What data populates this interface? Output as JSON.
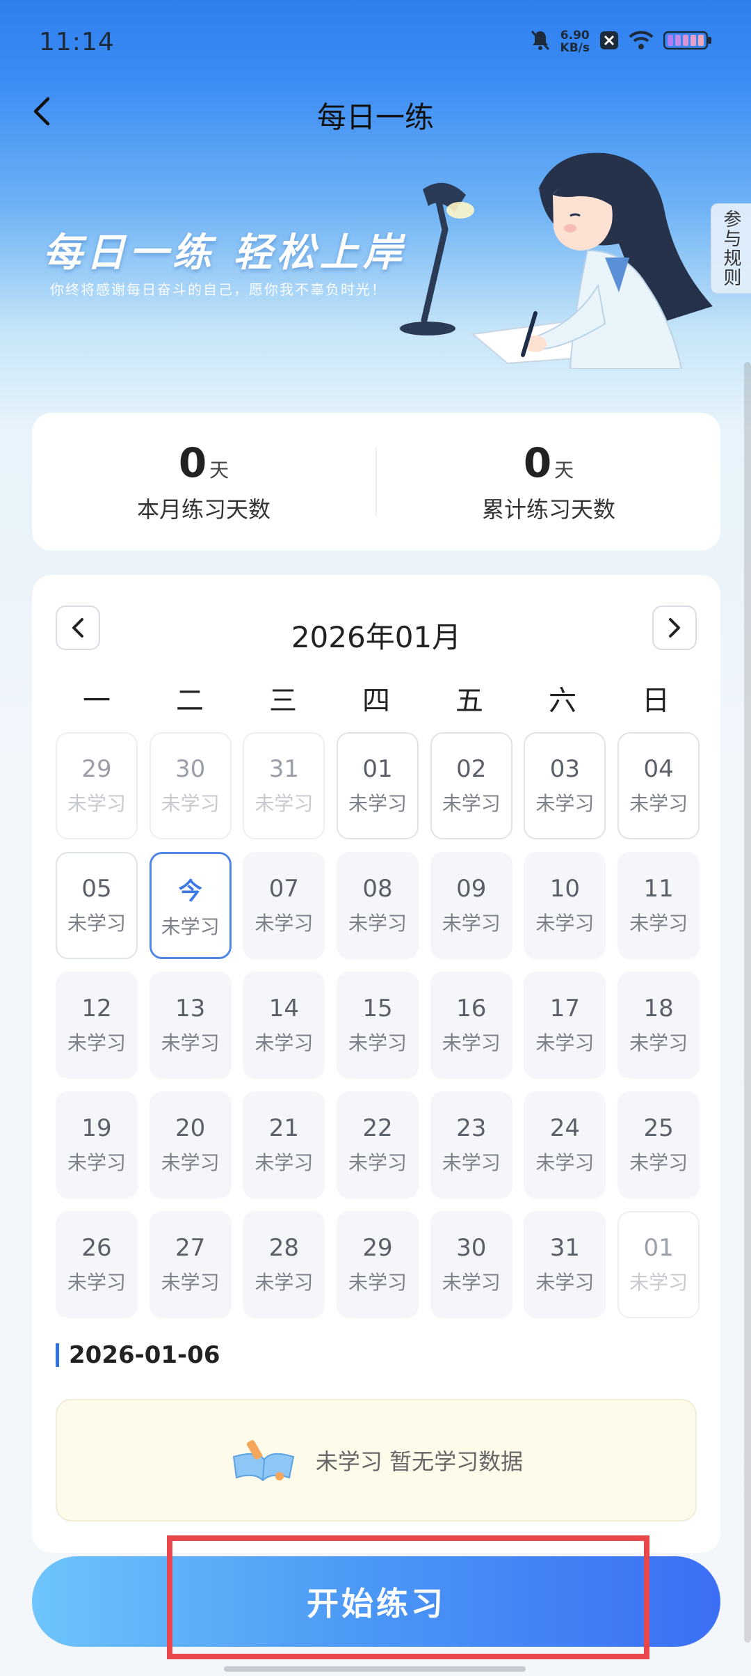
{
  "status_bar": {
    "time": "11:14",
    "speed_value": "6.90",
    "speed_unit": "KB/s"
  },
  "nav": {
    "title": "每日一练"
  },
  "banner": {
    "slogan": "每日一练  轻松上岸",
    "subtitle": "你终将感谢每日奋斗的自己，愿你我不辜负时光！",
    "rules_tab": "参与规则"
  },
  "stats": [
    {
      "value": "0",
      "unit": "天",
      "label": "本月练习天数"
    },
    {
      "value": "0",
      "unit": "天",
      "label": "累计练习天数"
    }
  ],
  "calendar": {
    "month": "2026年01月",
    "weekdays": [
      "一",
      "二",
      "三",
      "四",
      "五",
      "六",
      "日"
    ],
    "days": [
      {
        "num": "29",
        "status": "未学习",
        "state": "faded"
      },
      {
        "num": "30",
        "status": "未学习",
        "state": "faded"
      },
      {
        "num": "31",
        "status": "未学习",
        "state": "faded"
      },
      {
        "num": "01",
        "status": "未学习",
        "state": "outline"
      },
      {
        "num": "02",
        "status": "未学习",
        "state": "outline"
      },
      {
        "num": "03",
        "status": "未学习",
        "state": "outline"
      },
      {
        "num": "04",
        "status": "未学习",
        "state": "outline"
      },
      {
        "num": "05",
        "status": "未学习",
        "state": "outline"
      },
      {
        "num": "今",
        "status": "未学习",
        "state": "today"
      },
      {
        "num": "07",
        "status": "未学习",
        "state": "future"
      },
      {
        "num": "08",
        "status": "未学习",
        "state": "future"
      },
      {
        "num": "09",
        "status": "未学习",
        "state": "future"
      },
      {
        "num": "10",
        "status": "未学习",
        "state": "future"
      },
      {
        "num": "11",
        "status": "未学习",
        "state": "future"
      },
      {
        "num": "12",
        "status": "未学习",
        "state": "future"
      },
      {
        "num": "13",
        "status": "未学习",
        "state": "future"
      },
      {
        "num": "14",
        "status": "未学习",
        "state": "future"
      },
      {
        "num": "15",
        "status": "未学习",
        "state": "future"
      },
      {
        "num": "16",
        "status": "未学习",
        "state": "future"
      },
      {
        "num": "17",
        "status": "未学习",
        "state": "future"
      },
      {
        "num": "18",
        "status": "未学习",
        "state": "future"
      },
      {
        "num": "19",
        "status": "未学习",
        "state": "future"
      },
      {
        "num": "20",
        "status": "未学习",
        "state": "future"
      },
      {
        "num": "21",
        "status": "未学习",
        "state": "future"
      },
      {
        "num": "22",
        "status": "未学习",
        "state": "future"
      },
      {
        "num": "23",
        "status": "未学习",
        "state": "future"
      },
      {
        "num": "24",
        "status": "未学习",
        "state": "future"
      },
      {
        "num": "25",
        "status": "未学习",
        "state": "future"
      },
      {
        "num": "26",
        "status": "未学习",
        "state": "future"
      },
      {
        "num": "27",
        "status": "未学习",
        "state": "future"
      },
      {
        "num": "28",
        "status": "未学习",
        "state": "future"
      },
      {
        "num": "29",
        "status": "未学习",
        "state": "future"
      },
      {
        "num": "30",
        "status": "未学习",
        "state": "future"
      },
      {
        "num": "31",
        "status": "未学习",
        "state": "future"
      },
      {
        "num": "01",
        "status": "未学习",
        "state": "faded"
      }
    ]
  },
  "selected": {
    "date": "2026-01-06",
    "empty_text": "未学习 暂无学习数据"
  },
  "action": {
    "start_label": "开始练习"
  },
  "colors": {
    "accent": "#3a78e6",
    "highlight": "#e8474b"
  }
}
